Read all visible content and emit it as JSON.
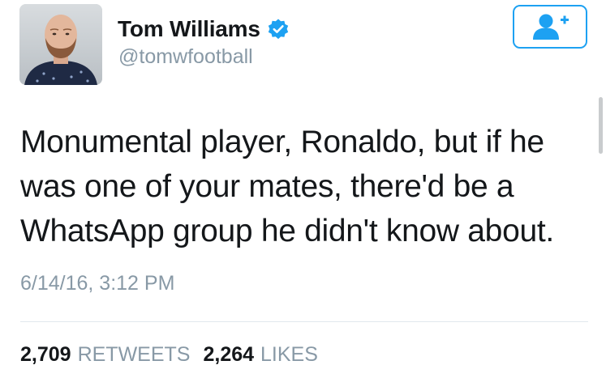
{
  "author": {
    "display_name": "Tom Williams",
    "handle": "@tomwfootball",
    "verified": true,
    "avatar_icon": "profile-photo"
  },
  "follow_button": {
    "icon": "follow-user-plus-icon",
    "color": "#1da1f2"
  },
  "tweet": {
    "text": "Monumental player, Ronaldo, but if he was one of your mates, there'd be a WhatsApp group he didn't know about.",
    "timestamp": "6/14/16, 3:12 PM"
  },
  "stats": {
    "retweets_count": "2,709",
    "retweets_label": "RETWEETS",
    "likes_count": "2,264",
    "likes_label": "LIKES"
  },
  "colors": {
    "accent": "#1da1f2",
    "muted_text": "#8899a6",
    "primary_text": "#14171a"
  }
}
